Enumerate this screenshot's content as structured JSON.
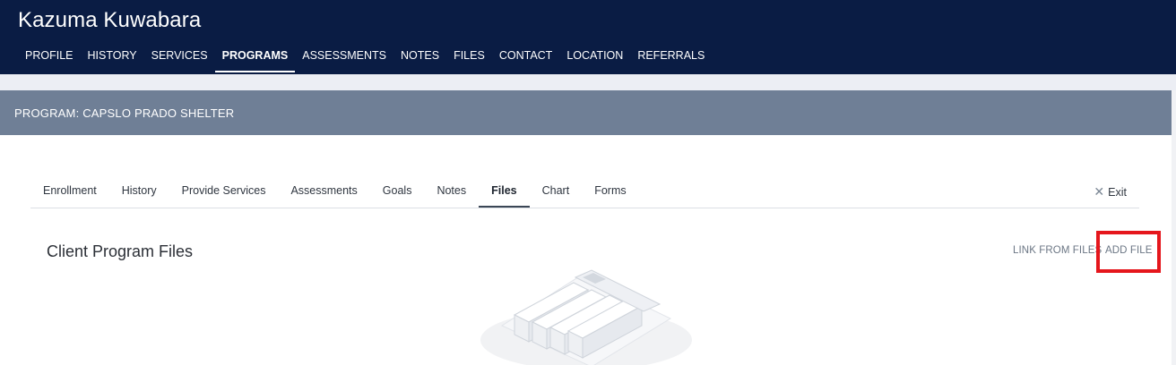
{
  "header": {
    "client_name": "Kazuma Kuwabara",
    "nav": [
      {
        "label": "PROFILE"
      },
      {
        "label": "HISTORY"
      },
      {
        "label": "SERVICES"
      },
      {
        "label": "PROGRAMS",
        "active": true
      },
      {
        "label": "ASSESSMENTS"
      },
      {
        "label": "NOTES"
      },
      {
        "label": "FILES"
      },
      {
        "label": "CONTACT"
      },
      {
        "label": "LOCATION"
      },
      {
        "label": "REFERRALS"
      }
    ]
  },
  "program": {
    "title": "PROGRAM: CAPSLO PRADO SHELTER"
  },
  "tabs": [
    {
      "label": "Enrollment"
    },
    {
      "label": "History"
    },
    {
      "label": "Provide Services"
    },
    {
      "label": "Assessments"
    },
    {
      "label": "Goals"
    },
    {
      "label": "Notes"
    },
    {
      "label": "Files",
      "active": true
    },
    {
      "label": "Chart"
    },
    {
      "label": "Forms"
    }
  ],
  "exit": {
    "label": "Exit",
    "icon": "close-icon"
  },
  "files_section": {
    "title": "Client Program Files",
    "link_from_files_label": "LINK FROM FILES",
    "add_file_label": "ADD FILE",
    "empty_state_icon": "empty-files-illustration"
  },
  "colors": {
    "header_bg": "#0a1c44",
    "program_bar_bg": "#6f7f96",
    "highlight_border": "#e5161c"
  }
}
